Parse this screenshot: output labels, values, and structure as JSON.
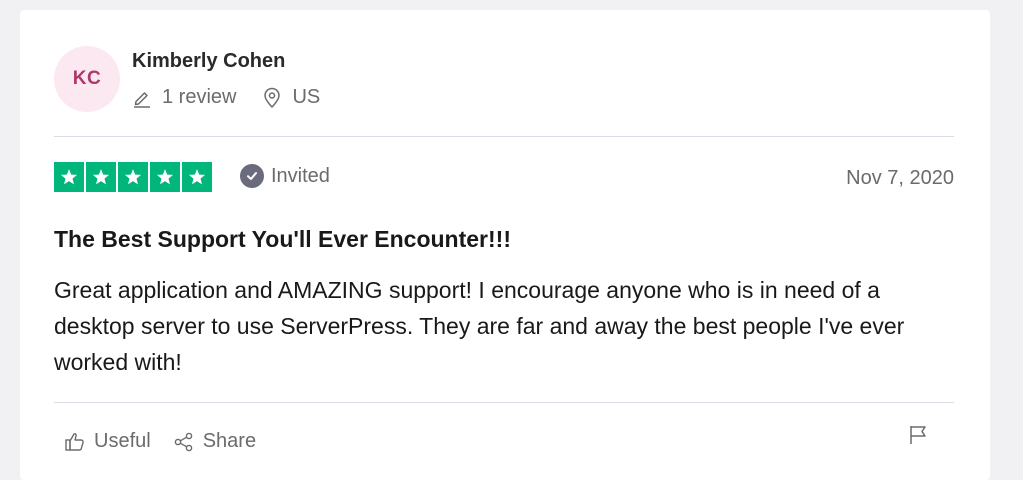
{
  "reviewer": {
    "initials": "KC",
    "name": "Kimberly Cohen",
    "review_count": "1 review",
    "location": "US"
  },
  "rating": {
    "stars": 5,
    "max": 5,
    "color": "#00b67a"
  },
  "status": {
    "label": "Invited"
  },
  "review": {
    "date": "Nov 7, 2020",
    "title": "The Best Support You'll Ever Encounter!!!",
    "body": "Great application and AMAZING support! I encourage anyone who is in need of a desktop server to use ServerPress. They are far and away the best people I've ever worked with!"
  },
  "actions": {
    "useful_label": "Useful",
    "share_label": "Share"
  },
  "icons": {
    "review_count": "pencil-icon",
    "location": "location-pin-icon",
    "invited": "checkmark-circle-icon",
    "useful": "thumbs-up-icon",
    "share": "share-icon",
    "report": "flag-icon"
  }
}
